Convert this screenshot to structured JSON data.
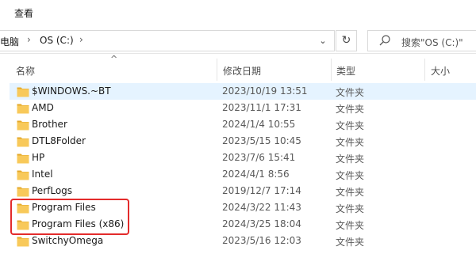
{
  "ribbon": {
    "view_tab": "查看"
  },
  "address": {
    "crumbs": [
      "电脑",
      "OS (C:)"
    ],
    "search_placeholder": "搜索\"OS (C:)\""
  },
  "columns": {
    "name": "名称",
    "date": "修改日期",
    "type": "类型",
    "size": "大小"
  },
  "files": [
    {
      "name": "$WINDOWS.~BT",
      "date": "2023/10/19 13:51",
      "type": "文件夹",
      "selected": true
    },
    {
      "name": "AMD",
      "date": "2023/11/1 17:31",
      "type": "文件夹"
    },
    {
      "name": "Brother",
      "date": "2024/1/4 10:55",
      "type": "文件夹"
    },
    {
      "name": "DTL8Folder",
      "date": "2023/5/15 10:45",
      "type": "文件夹"
    },
    {
      "name": "HP",
      "date": "2023/7/6 15:41",
      "type": "文件夹"
    },
    {
      "name": "Intel",
      "date": "2024/4/1 8:56",
      "type": "文件夹"
    },
    {
      "name": "PerfLogs",
      "date": "2019/12/7 17:14",
      "type": "文件夹"
    },
    {
      "name": "Program Files",
      "date": "2024/3/22 11:43",
      "type": "文件夹"
    },
    {
      "name": "Program Files (x86)",
      "date": "2024/3/25 18:04",
      "type": "文件夹"
    },
    {
      "name": "SwitchyOmega",
      "date": "2023/5/16 12:03",
      "type": "文件夹"
    }
  ],
  "colors": {
    "folder": "#f8c95a",
    "folder_dark": "#e5a92a",
    "selection": "#e5f3ff",
    "highlight": "#e32b2b"
  },
  "icons": {
    "folder": "folder-icon",
    "search": "search-icon",
    "refresh": "refresh-icon"
  }
}
